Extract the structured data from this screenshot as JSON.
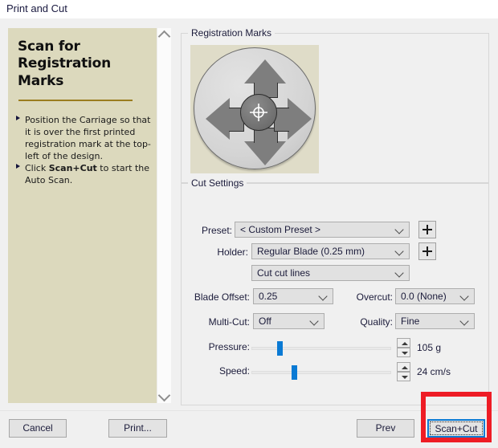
{
  "window": {
    "title": "Print and Cut"
  },
  "instructions": {
    "heading_line1": "Scan for",
    "heading_line2": "Registration Marks",
    "bullets": [
      {
        "text_before": "Position the Carriage so that it is over the first printed registration mark at the top-left of the design.",
        "bold": "",
        "text_after": ""
      },
      {
        "text_before": "Click ",
        "bold": "Scan+Cut",
        "text_after": " to start the Auto Scan."
      }
    ]
  },
  "scrollbar": {
    "up_icon": "chevron-up-icon",
    "down_icon": "chevron-down-icon"
  },
  "registration": {
    "group_title": "Registration Marks",
    "dpad": {
      "up": "arrow-up-button",
      "down": "arrow-down-button",
      "left": "arrow-left-button",
      "right": "arrow-right-button",
      "center": "crosshair-target-button"
    }
  },
  "cut_settings": {
    "group_title": "Cut Settings",
    "preset": {
      "label": "Preset:",
      "value": "< Custom Preset >",
      "add_label": "+"
    },
    "holder": {
      "label": "Holder:",
      "value": "Regular Blade (0.25 mm)",
      "add_label": "+"
    },
    "action": {
      "value": "Cut cut lines"
    },
    "blade_offset": {
      "label": "Blade Offset:",
      "value": "0.25"
    },
    "overcut": {
      "label": "Overcut:",
      "value": "0.0 (None)"
    },
    "multi_cut": {
      "label": "Multi-Cut:",
      "value": "Off"
    },
    "quality": {
      "label": "Quality:",
      "value": "Fine"
    },
    "pressure": {
      "label": "Pressure:",
      "value": "105 g",
      "percent": 18
    },
    "speed": {
      "label": "Speed:",
      "value": "24 cm/s",
      "percent": 28
    }
  },
  "footer": {
    "cancel": "Cancel",
    "print": "Print...",
    "prev": "Prev",
    "scan_cut": "Scan+Cut"
  },
  "annotation": {
    "highlight_color": "#ee1c25"
  }
}
